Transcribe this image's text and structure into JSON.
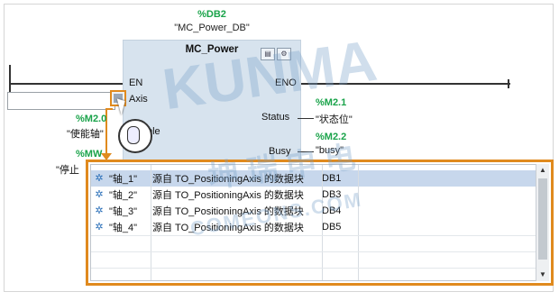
{
  "instance": {
    "db_name": "%DB2",
    "db_symbol": "\"MC_Power_DB\""
  },
  "block": {
    "title": "MC_Power",
    "pins": {
      "en": "EN",
      "eno": "ENO",
      "axis": "Axis",
      "enable": "ble",
      "status": "Status",
      "busy": "Busy"
    }
  },
  "left_tags": {
    "enable_addr": "%M2.0",
    "enable_name": "\"使能轴\"",
    "stop_addr": "%MW",
    "stop_name": "\"停止"
  },
  "right_tags": {
    "status_addr": "%M2.1",
    "status_name": "\"状态位\"",
    "busy_addr": "%M2.2",
    "busy_name": "\"busy\""
  },
  "dropdown": {
    "rows": [
      {
        "name": "\"轴_1\"",
        "desc": "源自 TO_PositioningAxis 的数据块",
        "db": "DB1"
      },
      {
        "name": "\"轴_2\"",
        "desc": "源自 TO_PositioningAxis 的数据块",
        "db": "DB3"
      },
      {
        "name": "\"轴_3\"",
        "desc": "源自 TO_PositioningAxis 的数据块",
        "db": "DB4"
      },
      {
        "name": "\"轴_4\"",
        "desc": "源自 TO_PositioningAxis 的数据块",
        "db": "DB5"
      }
    ],
    "selected_index": 0
  },
  "watermark": {
    "big": "KUNMA",
    "cn": "坤 瑞 申 电",
    "site": "COMEONS.COM"
  },
  "icons": {
    "axis_browse": "object-browse-icon",
    "mouse": "mouse-icon",
    "row": "technology-object-icon",
    "scroll_up": "chevron-up-icon",
    "scroll_down": "chevron-down-icon"
  },
  "colors": {
    "highlight": "#e08a1e",
    "tag_green": "#1aa34a",
    "block_fill": "#d7e3ee",
    "row_selected": "#c7d7ec"
  }
}
